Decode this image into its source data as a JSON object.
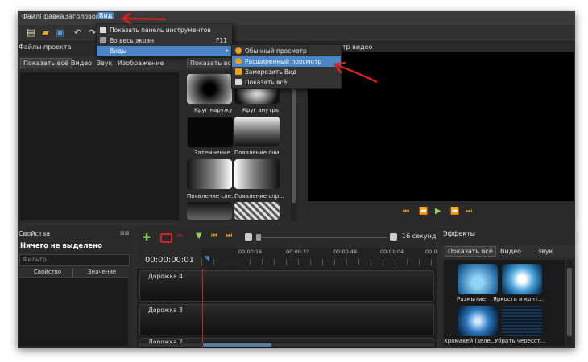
{
  "menubar": {
    "file": "Файл",
    "edit": "Правка",
    "title": "Заголовок",
    "view": "Вид"
  },
  "view_menu": {
    "show_toolbar": "Показать панель инструментов",
    "fullscreen": "Во весь экран",
    "fullscreen_shortcut": "F11",
    "views": "Виды"
  },
  "views_submenu": {
    "simple": "Обычный просмотр",
    "advanced": "Расширенный просмотр",
    "freeze": "Заморозить Вид",
    "show_all": "Показать всё"
  },
  "project_files": {
    "title": "Файлы проекта",
    "tabs": [
      "Показать всё",
      "Видео",
      "Звук",
      "Изображение"
    ]
  },
  "transitions": {
    "tab_show_all": "Показать все",
    "items": [
      "Круг наружу",
      "Круг внутрь",
      "Затемнение",
      "Появление сни...",
      "Появление сле...",
      "Появление спр..."
    ]
  },
  "preview": {
    "title_fragment": "отр видео"
  },
  "properties": {
    "title": "Свойства",
    "nothing_selected": "Ничего не выделено",
    "filter_placeholder": "Фильтр",
    "col_property": "Свойство",
    "col_value": "Значение"
  },
  "timeline": {
    "timecode": "00:00:00:01",
    "zoom_label": "16 секунд",
    "ticks": [
      "00:00:16",
      "00:00:32",
      "00:00:48",
      "00:01:04",
      "00:0"
    ],
    "tracks": [
      "Дорожка 4",
      "Дорожка 3",
      "Дорожка 2"
    ]
  },
  "effects": {
    "title": "Эффекты",
    "tabs": [
      "Показать всё",
      "Видео",
      "Звук"
    ],
    "items": [
      "Размытие",
      "Яркость и конт...",
      "Хромакей (зеле...",
      "Убрать чересст..."
    ]
  },
  "colors": {
    "accent_blue": "#4a86c7",
    "highlight_orange": "#e8a020",
    "arrow_red": "#d42020"
  }
}
